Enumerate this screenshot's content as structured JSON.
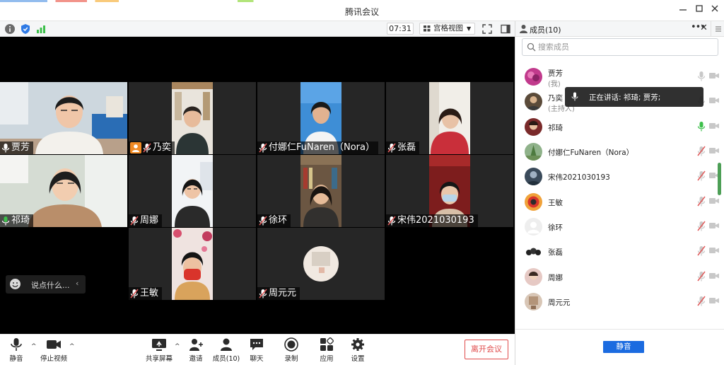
{
  "window": {
    "title": "腾讯会议"
  },
  "status": {
    "clock": "07:31",
    "view_mode": "宫格视图"
  },
  "tiles": [
    {
      "name": "贾芳",
      "mic": "on",
      "active": true
    },
    {
      "name": "乃奕",
      "mic": "muted",
      "host": true
    },
    {
      "name": "付娜仁FuNaren（Nora）",
      "mic": "muted"
    },
    {
      "name": "张磊",
      "mic": "muted"
    },
    {
      "name": "祁琦",
      "mic": "on",
      "active": true
    },
    {
      "name": "周娜",
      "mic": "muted"
    },
    {
      "name": "徐环",
      "mic": "muted"
    },
    {
      "name": "宋伟2021030193",
      "mic": "muted"
    },
    {
      "name": "王敏",
      "mic": "muted"
    },
    {
      "name": "周元元",
      "mic": "muted"
    }
  ],
  "chat": {
    "placeholder": "说点什么..."
  },
  "toolbar": {
    "mute": "静音",
    "stop_video": "停止视频",
    "share_screen": "共享屏幕",
    "invite": "邀请",
    "members": "成员(10)",
    "chat": "聊天",
    "record": "录制",
    "apps": "应用",
    "settings": "设置",
    "leave": "离开会议"
  },
  "panel": {
    "title": "成员(10)",
    "search_placeholder": "搜索成员",
    "mute_all": "静音",
    "speaking": "正在讲话: 祁琦; 贾芳;",
    "members": [
      {
        "name": "贾芳",
        "tag": "(我)",
        "mic": "idle"
      },
      {
        "name": "乃奕",
        "tag": "(主持人)",
        "mic": "idle"
      },
      {
        "name": "祁琦",
        "tag": "",
        "mic": "talking"
      },
      {
        "name": "付娜仁FuNaren（Nora）",
        "tag": "",
        "mic": "muted"
      },
      {
        "name": "宋伟2021030193",
        "tag": "",
        "mic": "muted"
      },
      {
        "name": "王敏",
        "tag": "",
        "mic": "muted"
      },
      {
        "name": "徐环",
        "tag": "",
        "mic": "muted"
      },
      {
        "name": "张磊",
        "tag": "",
        "mic": "muted"
      },
      {
        "name": "周娜",
        "tag": "",
        "mic": "muted"
      },
      {
        "name": "周元元",
        "tag": "",
        "mic": "muted"
      }
    ]
  },
  "colors": {
    "accent": "#1b6be0",
    "leave": "#e04b4b",
    "talking": "#3cbf4a",
    "muted": "#e05a5a"
  }
}
